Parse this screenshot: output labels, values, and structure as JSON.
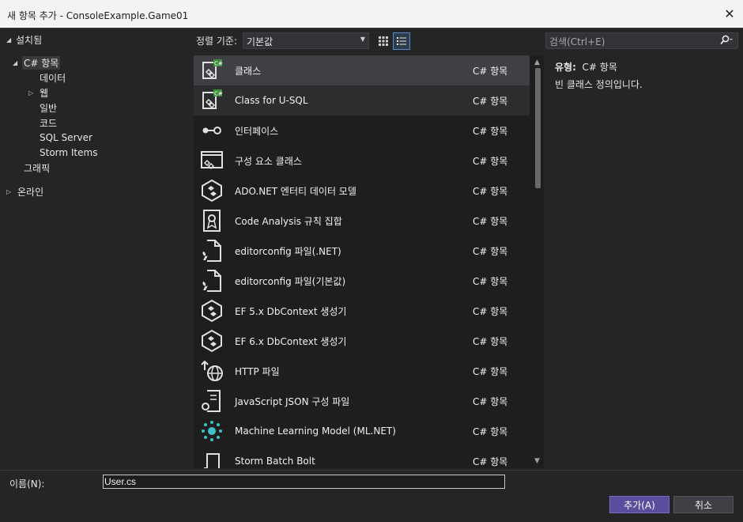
{
  "window": {
    "title": "새 항목 추가 - ConsoleExample.Game01"
  },
  "tree": {
    "installed": "설치됨",
    "csharp": "C# 항목",
    "data": "데이터",
    "web": "웹",
    "general": "일반",
    "code": "코드",
    "sqlserver": "SQL Server",
    "storm": "Storm Items",
    "graphics": "그래픽",
    "online": "온라인"
  },
  "toolbar": {
    "sort_label": "정렬 기준:",
    "sort_value": "기본값",
    "search_placeholder": "검색(Ctrl+E)"
  },
  "templates": [
    {
      "name": "클래스",
      "type": "C# 항목",
      "icon": "class-icon"
    },
    {
      "name": "Class for U-SQL",
      "type": "C# 항목",
      "icon": "class-icon"
    },
    {
      "name": "인터페이스",
      "type": "C# 항목",
      "icon": "interface-icon"
    },
    {
      "name": "구성 요소 클래스",
      "type": "C# 항목",
      "icon": "component-class-icon"
    },
    {
      "name": "ADO.NET 엔터티 데이터 모델",
      "type": "C# 항목",
      "icon": "entity-model-icon"
    },
    {
      "name": "Code Analysis 규칙 집합",
      "type": "C# 항목",
      "icon": "ruleset-icon"
    },
    {
      "name": "editorconfig 파일(.NET)",
      "type": "C# 항목",
      "icon": "config-file-icon"
    },
    {
      "name": "editorconfig 파일(기본값)",
      "type": "C# 항목",
      "icon": "config-file-icon"
    },
    {
      "name": "EF 5.x DbContext 생성기",
      "type": "C# 항목",
      "icon": "entity-model-icon"
    },
    {
      "name": "EF 6.x DbContext 생성기",
      "type": "C# 항목",
      "icon": "entity-model-icon"
    },
    {
      "name": "HTTP 파일",
      "type": "C# 항목",
      "icon": "http-file-icon"
    },
    {
      "name": "JavaScript JSON 구성 파일",
      "type": "C# 항목",
      "icon": "json-config-icon"
    },
    {
      "name": "Machine Learning Model (ML.NET)",
      "type": "C# 항목",
      "icon": "ml-model-icon"
    },
    {
      "name": "Storm Batch Bolt",
      "type": "C# 항목",
      "icon": "storm-bolt-icon"
    }
  ],
  "info": {
    "type_label": "유형:",
    "type_value": "C# 항목",
    "description": "빈 클래스 정의입니다."
  },
  "bottom": {
    "name_label": "이름(N):",
    "name_value": "User.cs",
    "add_button": "추가(A)",
    "cancel_button": "취소"
  },
  "colors": {
    "accent": "#5b4c9e",
    "selection": "#3f3f46",
    "background": "#252526",
    "list_background": "#1e1e1e"
  }
}
